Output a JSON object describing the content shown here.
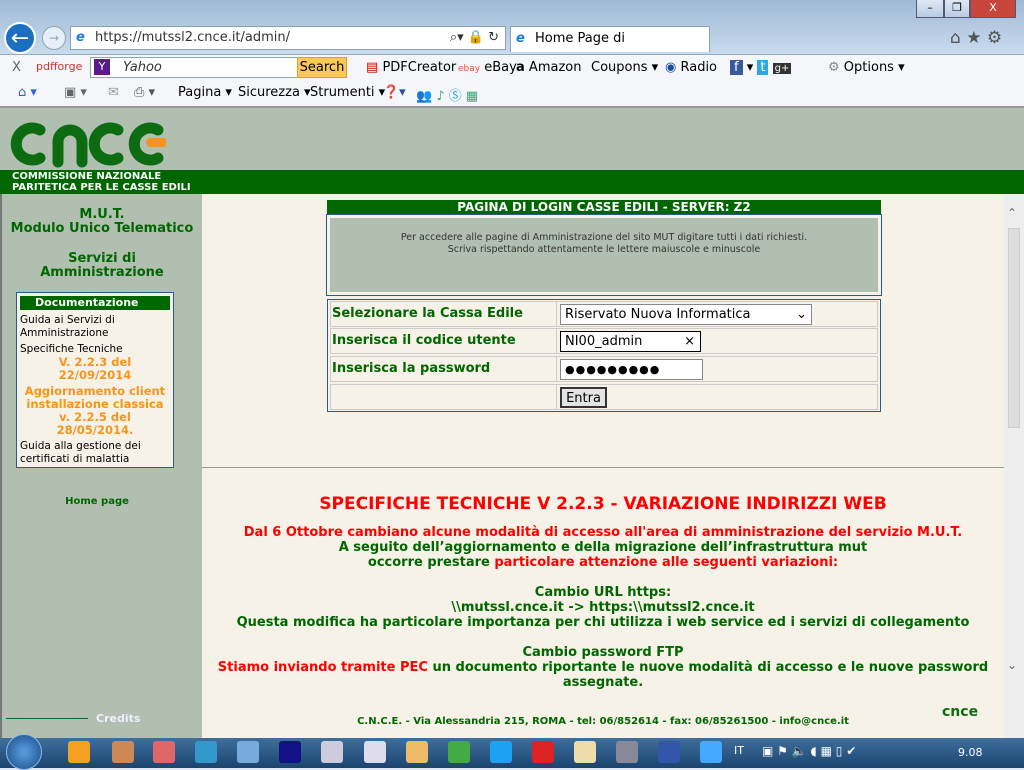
{
  "browser": {
    "url": "https://mutssl2.cnce.it/admin/",
    "tab_title": "Home Page di Amministraz...",
    "tab_close": "×"
  },
  "toolbar1": {
    "close": "X",
    "pdfforge": "pdfforge",
    "search_placeholder": "Yahoo",
    "search_button": "Search",
    "items": [
      "PDFCreator",
      "eBay",
      "Amazon",
      "Coupons",
      "Radio",
      "Options"
    ]
  },
  "toolbar2": {
    "items": [
      "Pagina",
      "Sicurezza",
      "Strumenti"
    ]
  },
  "header": {
    "logo": "cnce",
    "org_line1": "COMMISSIONE NAZIONALE",
    "org_line2": "PARITETICA PER LE CASSE EDILI"
  },
  "sidebar": {
    "mut": "M.U.T.",
    "mut_full": "Modulo Unico Telematico",
    "services_line1": "Servizi di",
    "services_line2": "Amministrazione",
    "doc": {
      "title": "Documentazione",
      "guide": "Guida ai Servizi di Amministrazione",
      "specs": "Specifiche Tecniche",
      "specs_version_1": "V. 2.2.3 del",
      "specs_version_2": "22/09/2014",
      "update_1": "Aggiornamento client",
      "update_2": "installazione classica",
      "update_3": "v. 2.2.5 del",
      "update_4": "28/05/2014.",
      "sick_guide": "Guida alla gestione dei certificati di malattia"
    },
    "home": "Home page",
    "credits": "Credits"
  },
  "login": {
    "title": "PAGINA DI LOGIN CASSE EDILI - SERVER: Z2",
    "info_1": "Per accedere alle pagine di Amministrazione del sito MUT digitare tutti i dati richiesti.",
    "info_2": "Scriva rispettando attentamente le lettere maiuscole e minuscole",
    "cassa_label": "Selezionare la Cassa Edile",
    "cassa_value": "Riservato Nuova Informatica",
    "user_label": "Inserisca il codice utente",
    "user_value": "NI00_admin",
    "password_label": "Inserisca la password",
    "password_value": "●●●●●●●●●",
    "submit": "Entra"
  },
  "notice": {
    "title": "SPECIFICHE TECNICHE V 2.2.3 - VARIAZIONE INDIRIZZI WEB",
    "p1": "Dal 6 Ottobre cambiano alcune modalità di accesso all'area di amministrazione del servizio M.U.T.",
    "p2": "A seguito dell’aggiornamento e della migrazione dell’infrastruttura mut",
    "p3a": "occorre prestare ",
    "p3b": "particolare attenzione alle seguenti variazioni:",
    "url_title": "Cambio URL https:",
    "url_change": "\\\\mutssl.cnce.it -> https:\\\\mutssl2.cnce.it",
    "url_note": "Questa modifica ha particolare importanza per chi utilizza i web service ed i servizi di collegamento",
    "ftp_title": "Cambio password FTP",
    "ftp_a": "Stiamo inviando tramite PEC",
    "ftp_b": " un documento riportante le nuove modalità di accesso e le nuove password assegnate."
  },
  "footer": {
    "address": "C.N.C.E. - Via Alessandria 215, ROMA - tel: 06/852614 - fax: 06/85261500 - info@cnce.it"
  },
  "taskbar": {
    "lang": "IT",
    "time": "9.08"
  },
  "colors": {
    "green": "#006600",
    "sage": "#b0bfb0",
    "cream": "#f6f2e7",
    "orange": "#f7941d",
    "red": "#ff0000"
  }
}
